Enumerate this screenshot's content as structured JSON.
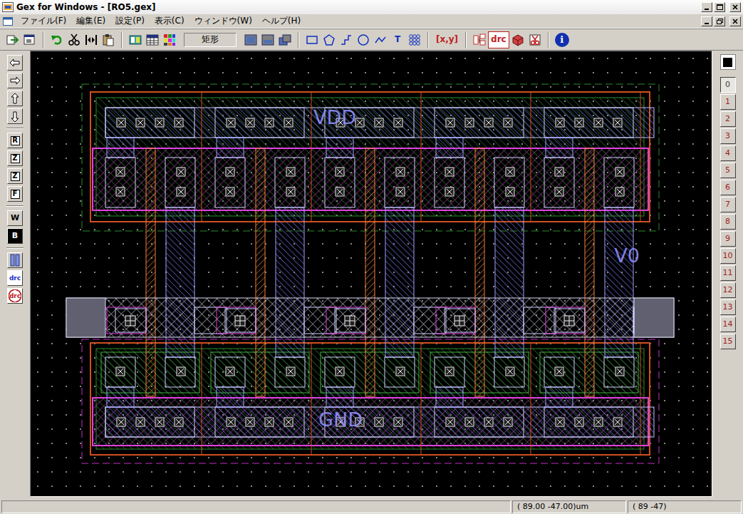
{
  "window": {
    "title": "Gex for Windows - [RO5.gex]"
  },
  "menu": [
    "ファイル(F)",
    "編集(E)",
    "設定(P)",
    "表示(C)",
    "ウィンドウ(W)",
    "ヘルプ(H)"
  ],
  "toolbar": {
    "shape_mode": "矩形",
    "text_tool": "T",
    "coord": "[x,y]",
    "drc": "drc",
    "info": "i"
  },
  "left_toolbar": [
    {
      "label": "R",
      "kind": "letter"
    },
    {
      "label": "Z",
      "kind": "letter"
    },
    {
      "label": "Z",
      "kind": "letter"
    },
    {
      "label": "F",
      "kind": "letter"
    },
    {
      "label": "W",
      "kind": "plain"
    },
    {
      "label": "B",
      "kind": "inverse"
    },
    {
      "label": "drc",
      "kind": "drc"
    },
    {
      "label": "drc",
      "kind": "drc-off"
    }
  ],
  "layers": [
    {
      "label": "0",
      "selected": true
    },
    {
      "label": "1",
      "selected": false
    },
    {
      "label": "2",
      "selected": false
    },
    {
      "label": "3",
      "selected": false
    },
    {
      "label": "4",
      "selected": false
    },
    {
      "label": "5",
      "selected": false
    },
    {
      "label": "6",
      "selected": false
    },
    {
      "label": "7",
      "selected": false
    },
    {
      "label": "8",
      "selected": false
    },
    {
      "label": "9",
      "selected": false
    },
    {
      "label": "10",
      "selected": false
    },
    {
      "label": "11",
      "selected": false
    },
    {
      "label": "12",
      "selected": false
    },
    {
      "label": "13",
      "selected": false
    },
    {
      "label": "14",
      "selected": false
    },
    {
      "label": "15",
      "selected": false
    }
  ],
  "canvas": {
    "labels": [
      {
        "text": "VDD"
      },
      {
        "text": "V0"
      },
      {
        "text": "GND"
      }
    ]
  },
  "status_bar": [
    "( 89.00 -47.00)um",
    "( 89 -47)"
  ]
}
